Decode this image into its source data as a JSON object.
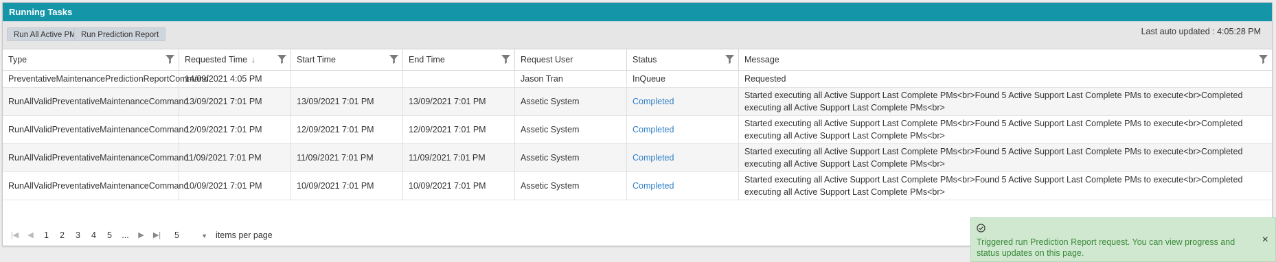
{
  "panel": {
    "title": "Running Tasks"
  },
  "toolbar": {
    "run_all_label": "Run All Active PMs",
    "run_prediction_label": "Run Prediction Report",
    "last_updated": "Last auto updated : 4:05:28 PM"
  },
  "grid": {
    "columns": [
      {
        "label": "Type",
        "filter_icon": "filter-icon"
      },
      {
        "label": "Requested Time",
        "sort_icon": "sort-down-arrow-icon",
        "filter_icon": "filter-icon"
      },
      {
        "label": "Start Time",
        "filter_icon": "filter-icon"
      },
      {
        "label": "End Time",
        "filter_icon": "filter-icon"
      },
      {
        "label": "Request User"
      },
      {
        "label": "Status",
        "filter_icon": "filter-icon"
      },
      {
        "label": "Message",
        "filter_icon": "filter-icon"
      }
    ],
    "rows": [
      {
        "type": "PreventativeMaintenancePredictionReportCommand",
        "requested": "14/09/2021 4:05 PM",
        "start": "",
        "end": "",
        "user": "Jason Tran",
        "status": "InQueue",
        "message": "Requested"
      },
      {
        "type": "RunAllValidPreventativeMaintenanceCommand",
        "requested": "13/09/2021 7:01 PM",
        "start": "13/09/2021 7:01 PM",
        "end": "13/09/2021 7:01 PM",
        "user": "Assetic System",
        "status": "Completed",
        "message": "Started executing all Active Support Last Complete PMs<br>Found 5 Active Support Last Complete PMs to execute<br>Completed executing all Active Support Last Complete PMs<br>"
      },
      {
        "type": "RunAllValidPreventativeMaintenanceCommand",
        "requested": "12/09/2021 7:01 PM",
        "start": "12/09/2021 7:01 PM",
        "end": "12/09/2021 7:01 PM",
        "user": "Assetic System",
        "status": "Completed",
        "message": "Started executing all Active Support Last Complete PMs<br>Found 5 Active Support Last Complete PMs to execute<br>Completed executing all Active Support Last Complete PMs<br>"
      },
      {
        "type": "RunAllValidPreventativeMaintenanceCommand",
        "requested": "11/09/2021 7:01 PM",
        "start": "11/09/2021 7:01 PM",
        "end": "11/09/2021 7:01 PM",
        "user": "Assetic System",
        "status": "Completed",
        "message": "Started executing all Active Support Last Complete PMs<br>Found 5 Active Support Last Complete PMs to execute<br>Completed executing all Active Support Last Complete PMs<br>"
      },
      {
        "type": "RunAllValidPreventativeMaintenanceCommand",
        "requested": "10/09/2021 7:01 PM",
        "start": "10/09/2021 7:01 PM",
        "end": "10/09/2021 7:01 PM",
        "user": "Assetic System",
        "status": "Completed",
        "message": "Started executing all Active Support Last Complete PMs<br>Found 5 Active Support Last Complete PMs to execute<br>Completed executing all Active Support Last Complete PMs<br>"
      }
    ]
  },
  "pager": {
    "first_icon": "first-page-icon",
    "prev_icon": "prev-page-icon",
    "pages": [
      "1",
      "2",
      "3",
      "4",
      "5",
      "..."
    ],
    "next_icon": "next-page-icon",
    "last_icon": "last-page-icon",
    "page_size": "5",
    "items_per_page": "items per page"
  },
  "toast": {
    "icon": "check-circle-icon",
    "text": "Triggered run Prediction Report request. You can view progress and status updates on this page.",
    "close": "×"
  },
  "colors": {
    "header_bg": "#1495a8",
    "link": "#2f7fc8",
    "toast_bg": "#cfe8cf",
    "toast_text": "#3c8a3c"
  }
}
